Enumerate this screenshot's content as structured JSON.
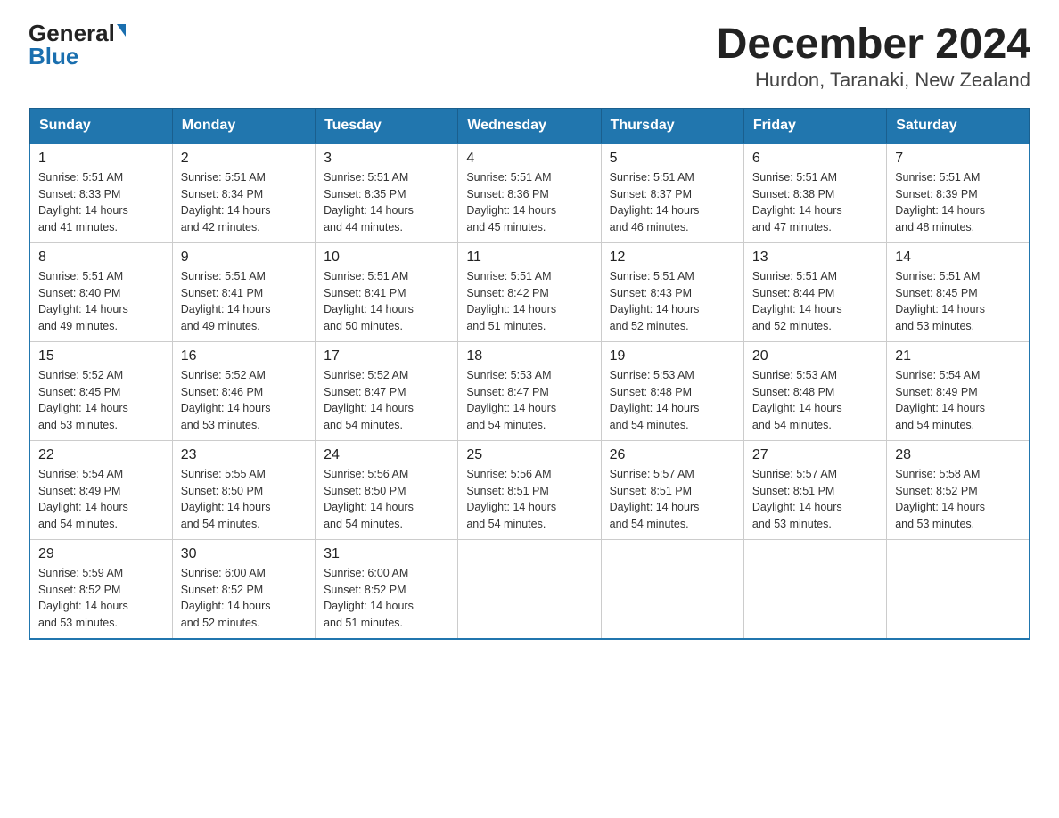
{
  "header": {
    "logo_general": "General",
    "logo_blue": "Blue",
    "title": "December 2024",
    "subtitle": "Hurdon, Taranaki, New Zealand"
  },
  "calendar": {
    "days_of_week": [
      "Sunday",
      "Monday",
      "Tuesday",
      "Wednesday",
      "Thursday",
      "Friday",
      "Saturday"
    ],
    "weeks": [
      [
        {
          "day": "1",
          "sunrise": "5:51 AM",
          "sunset": "8:33 PM",
          "daylight": "14 hours and 41 minutes."
        },
        {
          "day": "2",
          "sunrise": "5:51 AM",
          "sunset": "8:34 PM",
          "daylight": "14 hours and 42 minutes."
        },
        {
          "day": "3",
          "sunrise": "5:51 AM",
          "sunset": "8:35 PM",
          "daylight": "14 hours and 44 minutes."
        },
        {
          "day": "4",
          "sunrise": "5:51 AM",
          "sunset": "8:36 PM",
          "daylight": "14 hours and 45 minutes."
        },
        {
          "day": "5",
          "sunrise": "5:51 AM",
          "sunset": "8:37 PM",
          "daylight": "14 hours and 46 minutes."
        },
        {
          "day": "6",
          "sunrise": "5:51 AM",
          "sunset": "8:38 PM",
          "daylight": "14 hours and 47 minutes."
        },
        {
          "day": "7",
          "sunrise": "5:51 AM",
          "sunset": "8:39 PM",
          "daylight": "14 hours and 48 minutes."
        }
      ],
      [
        {
          "day": "8",
          "sunrise": "5:51 AM",
          "sunset": "8:40 PM",
          "daylight": "14 hours and 49 minutes."
        },
        {
          "day": "9",
          "sunrise": "5:51 AM",
          "sunset": "8:41 PM",
          "daylight": "14 hours and 49 minutes."
        },
        {
          "day": "10",
          "sunrise": "5:51 AM",
          "sunset": "8:41 PM",
          "daylight": "14 hours and 50 minutes."
        },
        {
          "day": "11",
          "sunrise": "5:51 AM",
          "sunset": "8:42 PM",
          "daylight": "14 hours and 51 minutes."
        },
        {
          "day": "12",
          "sunrise": "5:51 AM",
          "sunset": "8:43 PM",
          "daylight": "14 hours and 52 minutes."
        },
        {
          "day": "13",
          "sunrise": "5:51 AM",
          "sunset": "8:44 PM",
          "daylight": "14 hours and 52 minutes."
        },
        {
          "day": "14",
          "sunrise": "5:51 AM",
          "sunset": "8:45 PM",
          "daylight": "14 hours and 53 minutes."
        }
      ],
      [
        {
          "day": "15",
          "sunrise": "5:52 AM",
          "sunset": "8:45 PM",
          "daylight": "14 hours and 53 minutes."
        },
        {
          "day": "16",
          "sunrise": "5:52 AM",
          "sunset": "8:46 PM",
          "daylight": "14 hours and 53 minutes."
        },
        {
          "day": "17",
          "sunrise": "5:52 AM",
          "sunset": "8:47 PM",
          "daylight": "14 hours and 54 minutes."
        },
        {
          "day": "18",
          "sunrise": "5:53 AM",
          "sunset": "8:47 PM",
          "daylight": "14 hours and 54 minutes."
        },
        {
          "day": "19",
          "sunrise": "5:53 AM",
          "sunset": "8:48 PM",
          "daylight": "14 hours and 54 minutes."
        },
        {
          "day": "20",
          "sunrise": "5:53 AM",
          "sunset": "8:48 PM",
          "daylight": "14 hours and 54 minutes."
        },
        {
          "day": "21",
          "sunrise": "5:54 AM",
          "sunset": "8:49 PM",
          "daylight": "14 hours and 54 minutes."
        }
      ],
      [
        {
          "day": "22",
          "sunrise": "5:54 AM",
          "sunset": "8:49 PM",
          "daylight": "14 hours and 54 minutes."
        },
        {
          "day": "23",
          "sunrise": "5:55 AM",
          "sunset": "8:50 PM",
          "daylight": "14 hours and 54 minutes."
        },
        {
          "day": "24",
          "sunrise": "5:56 AM",
          "sunset": "8:50 PM",
          "daylight": "14 hours and 54 minutes."
        },
        {
          "day": "25",
          "sunrise": "5:56 AM",
          "sunset": "8:51 PM",
          "daylight": "14 hours and 54 minutes."
        },
        {
          "day": "26",
          "sunrise": "5:57 AM",
          "sunset": "8:51 PM",
          "daylight": "14 hours and 54 minutes."
        },
        {
          "day": "27",
          "sunrise": "5:57 AM",
          "sunset": "8:51 PM",
          "daylight": "14 hours and 53 minutes."
        },
        {
          "day": "28",
          "sunrise": "5:58 AM",
          "sunset": "8:52 PM",
          "daylight": "14 hours and 53 minutes."
        }
      ],
      [
        {
          "day": "29",
          "sunrise": "5:59 AM",
          "sunset": "8:52 PM",
          "daylight": "14 hours and 53 minutes."
        },
        {
          "day": "30",
          "sunrise": "6:00 AM",
          "sunset": "8:52 PM",
          "daylight": "14 hours and 52 minutes."
        },
        {
          "day": "31",
          "sunrise": "6:00 AM",
          "sunset": "8:52 PM",
          "daylight": "14 hours and 51 minutes."
        },
        null,
        null,
        null,
        null
      ]
    ],
    "labels": {
      "sunrise": "Sunrise:",
      "sunset": "Sunset:",
      "daylight": "Daylight:"
    }
  }
}
